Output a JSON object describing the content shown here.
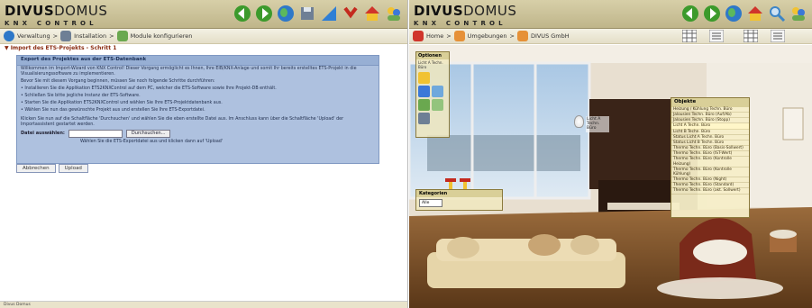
{
  "left": {
    "logo": {
      "brand_bold": "DIVUS",
      "brand_light": "DOMUS",
      "sub": "KNX CONTROL"
    },
    "breadcrumb": [
      {
        "label": "Verwaltung"
      },
      {
        "label": "Installation"
      },
      {
        "label": "Module konfigurieren"
      }
    ],
    "section_title": "Import des ETS-Projekts - Schritt 1",
    "panel": {
      "header": "Export des Projektes aus der ETS-Datenbank",
      "intro": "Willkommen im Import-Wizard von KNX Control! Dieser Vorgang ermöglicht es Ihnen, Ihre EIB/KNX-Anlage und somit Ihr bereits erstelltes ETS-Projekt in die Visualisierungssoftware zu implementieren.",
      "before": "Bevor Sie mit diesem Vorgang beginnen, müssen Sie noch folgende Schritte durchführen:",
      "steps": [
        "Installieren Sie die Applikation ETS2KNXControl auf dem PC, welcher die ETS-Software sowie Ihre Projekt-DB enthält.",
        "Schließen Sie bitte jegliche Instanz der ETS-Software.",
        "Starten Sie die Applikation ETS2KNXControl und wählen Sie Ihre ETS-Projektdatenbank aus.",
        "Wählen Sie nun das gewünschte Projekt aus und erstellen Sie Ihre ETS-Exportdatei."
      ],
      "instruction": "Klicken Sie nun auf die Schaltfläche 'Durchsuchen' und wählen Sie die eben erstellte Datei aus. Im Anschluss kann über die Schaltfläche 'Upload' der Importassistent gestartet werden.",
      "file_label": "Datei auswählen:",
      "browse_label": "Durchsuchen...",
      "hint": "Wählen Sie die ETS-Exportdatei aus und klicken dann auf 'Upload'"
    },
    "buttons": {
      "cancel": "Abbrechen",
      "upload": "Upload"
    },
    "footer": "Divus Domus"
  },
  "right": {
    "logo": {
      "brand_bold": "DIVUS",
      "brand_light": "DOMUS",
      "sub": "KNX CONTROL"
    },
    "breadcrumb": [
      {
        "label": "Home"
      },
      {
        "label": "Umgebungen"
      },
      {
        "label": "DIVUS GmbH"
      }
    ],
    "options": {
      "title": "Optionen",
      "subtitle": "Licht A Techn. Büro"
    },
    "light_label": "Licht A Techn. Büro",
    "categories": {
      "title": "Kategorien",
      "selected": "Alle"
    },
    "objects": {
      "title": "Objekte",
      "items": [
        "Heizung / Kühlung Techn. Büro",
        "Jalousien Techn. Büro (Auf/Ab)",
        "Jalousien Techn. Büro (Stopp)",
        "Licht A Techn. Büro",
        "Licht B Techn. Büro",
        "Status Licht A Techn. Büro",
        "Status Licht B Techn. Büro",
        "Thermo Techn. Büro (Basis-Sollwert)",
        "Thermo Techn. Büro (IST-Wert)",
        "Thermo Techn. Büro (Kontrolle Heizung)",
        "Thermo Techn. Büro (Kontrolle Kühlung)",
        "Thermo Techn. Büro (Night)",
        "Thermo Techn. Büro (Standard)",
        "Thermo Techn. Büro (akt. Sollwert)"
      ],
      "selected_index": 3
    }
  }
}
